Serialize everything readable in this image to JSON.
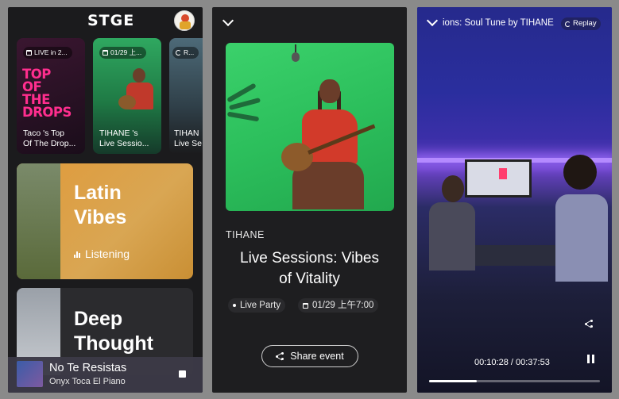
{
  "home": {
    "logo": "STGE",
    "events": [
      {
        "badge": "LIVE in 2...",
        "title": "Taco 's Top\nOf The Drop...",
        "art_text": "TOP\nOF\nTHE\nDROPS"
      },
      {
        "badge": "01/29 上...",
        "title": "TIHANE 's\nLive Sessio..."
      },
      {
        "badge": "R...",
        "title": "TIHAN\nLive Se"
      }
    ],
    "playlists": [
      {
        "title": "Latin\nVibes",
        "status": "Listening"
      },
      {
        "title": "Deep\nThought"
      }
    ],
    "now_playing": {
      "title": "No Te Resistas",
      "artist": "Onyx Toca El Piano"
    }
  },
  "event_detail": {
    "artist": "TIHANE",
    "title": "Live Sessions: Vibes\nof Vitality",
    "type": "Live Party",
    "date": "01/29 上午7:00",
    "share_label": "Share event"
  },
  "player": {
    "title": "ions: Soul Tune by TIHANE",
    "replay_label": "Replay",
    "current_time": "00:10:28",
    "duration": "00:37:53",
    "time_display": "00:10:28 / 00:37:53",
    "progress": 0.277
  },
  "colors": {
    "drops_pink": "#ff2e8e",
    "hero_green": "#2cbf5c",
    "latin_orange": "#e09a3a",
    "neon_purple": "#b48aff"
  }
}
